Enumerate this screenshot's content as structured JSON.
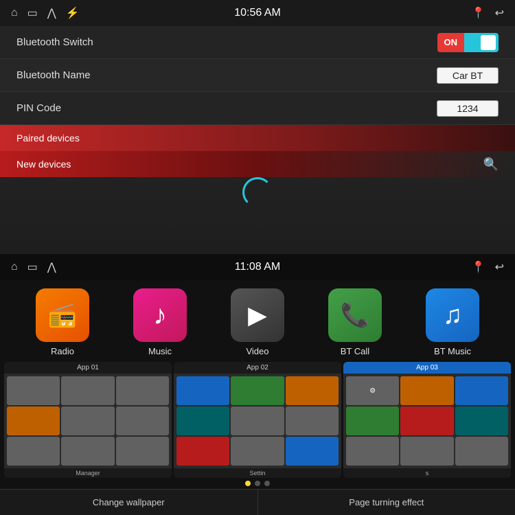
{
  "top": {
    "statusBar": {
      "time": "10:56 AM",
      "icons_left": [
        "home",
        "screen",
        "chevron-up",
        "usb"
      ],
      "icons_right": [
        "location",
        "back"
      ]
    },
    "settings": [
      {
        "label": "Bluetooth Switch",
        "type": "toggle",
        "value": "ON"
      },
      {
        "label": "Bluetooth Name",
        "type": "input",
        "value": "Car BT"
      },
      {
        "label": "PIN Code",
        "type": "input",
        "value": "1234"
      }
    ],
    "sections": [
      {
        "id": "paired",
        "label": "Paired devices",
        "hasSearch": false
      },
      {
        "id": "new",
        "label": "New devices",
        "hasSearch": true
      }
    ]
  },
  "bottom": {
    "statusBar": {
      "time": "11:08 AM",
      "icons_left": [
        "home",
        "screen",
        "chevron-up"
      ],
      "icons_right": [
        "location",
        "back"
      ]
    },
    "apps": [
      {
        "id": "radio",
        "label": "Radio",
        "icon": "📻"
      },
      {
        "id": "music",
        "label": "Music",
        "icon": "♪"
      },
      {
        "id": "video",
        "label": "Video",
        "icon": "▶"
      },
      {
        "id": "btcall",
        "label": "BT Call",
        "icon": "📞"
      },
      {
        "id": "btmusic",
        "label": "BT Music",
        "icon": "♫"
      }
    ],
    "thumbnails": [
      {
        "label": "App 01",
        "sublabel": "Manager",
        "active": false
      },
      {
        "label": "App 02",
        "sublabel": "Settin",
        "active": false
      },
      {
        "label": "App 03",
        "sublabel": "s",
        "active": true
      }
    ],
    "dots": [
      true,
      false,
      false
    ],
    "bottomBar": [
      {
        "id": "wallpaper",
        "label": "Change wallpaper"
      },
      {
        "id": "page-effect",
        "label": "Page turning effect"
      }
    ]
  }
}
